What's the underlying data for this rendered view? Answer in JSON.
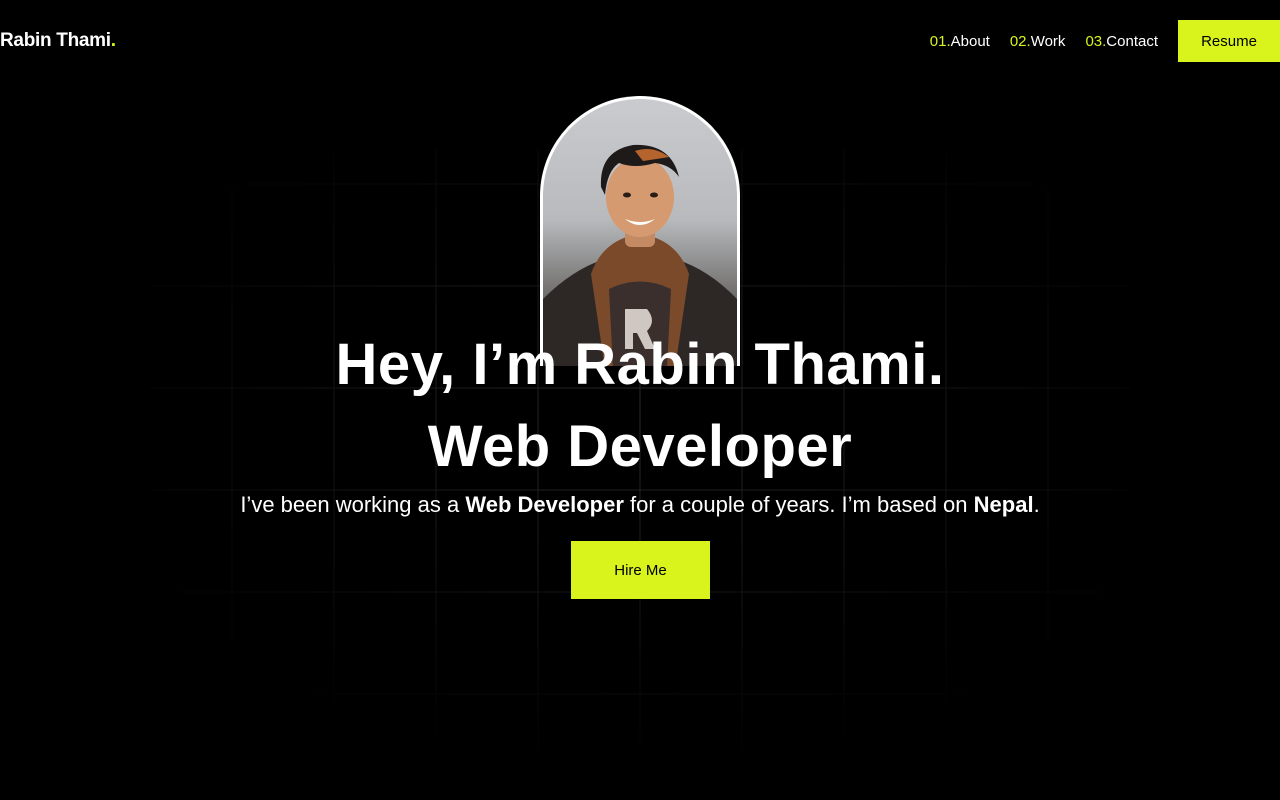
{
  "header": {
    "logo_text": "Rabin Thami",
    "logo_dot": ".",
    "nav": [
      {
        "num": "01.",
        "label": "About"
      },
      {
        "num": "02.",
        "label": "Work"
      },
      {
        "num": "03.",
        "label": "Contact"
      }
    ],
    "resume_label": "Resume"
  },
  "hero": {
    "title": "Hey, I’m Rabin Thami.",
    "role": "Web Developer",
    "desc_part1": "I’ve been working as a ",
    "desc_bold1": "Web Developer",
    "desc_part2": " for a couple of years. I’m based on ",
    "desc_bold2": "Nepal",
    "desc_part3": ".",
    "hire_label": "Hire Me"
  },
  "colors": {
    "accent": "#d9f41d",
    "background": "#000000",
    "text": "#ffffff"
  },
  "icons": {
    "portrait": "profile-photo"
  }
}
